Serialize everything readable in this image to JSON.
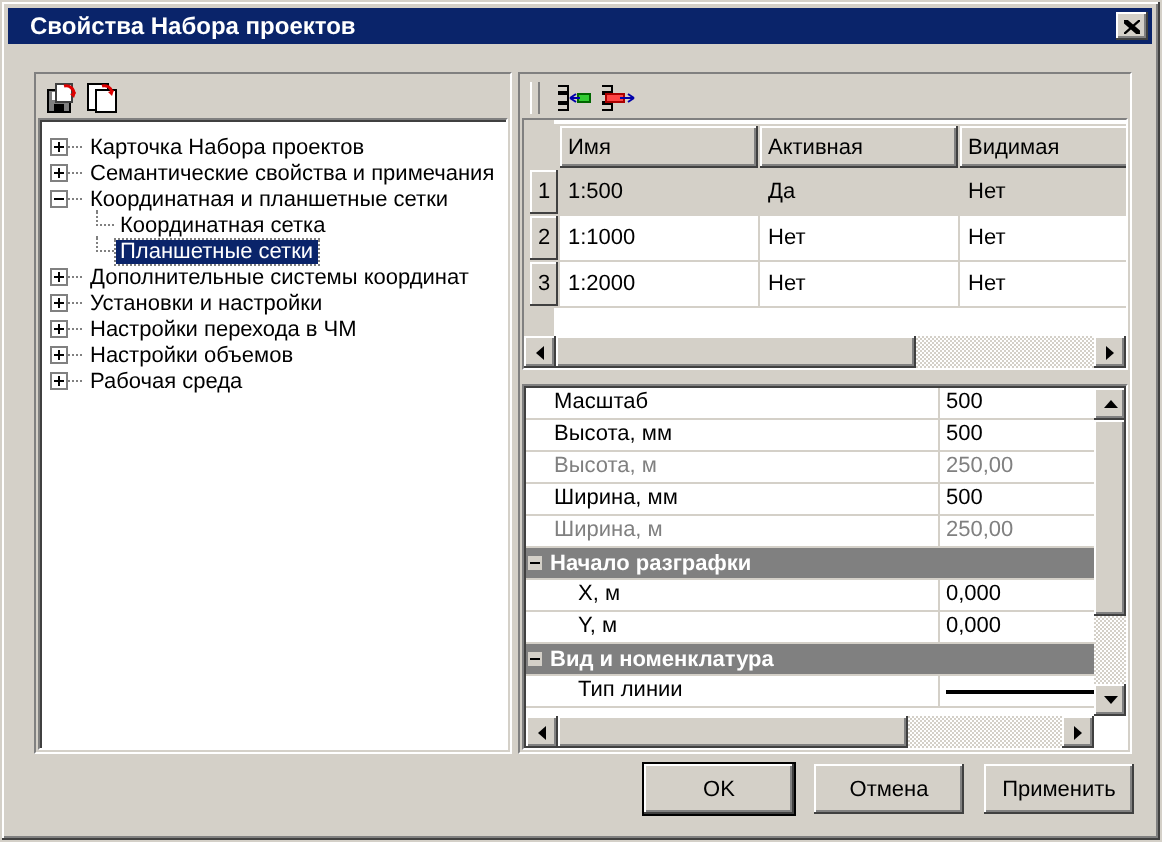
{
  "window": {
    "title": "Свойства Набора проектов"
  },
  "tree": [
    {
      "label": "Карточка Набора проектов",
      "expanded": false,
      "selected": false
    },
    {
      "label": "Семантические свойства и примечания",
      "expanded": false,
      "selected": false
    },
    {
      "label": "Координатная и планшетные сетки",
      "expanded": true,
      "selected": false,
      "children": [
        {
          "label": "Координатная сетка",
          "selected": false
        },
        {
          "label": "Планшетные сетки",
          "selected": true
        }
      ]
    },
    {
      "label": "Дополнительные системы координат",
      "expanded": false,
      "selected": false
    },
    {
      "label": "Установки и настройки",
      "expanded": false,
      "selected": false
    },
    {
      "label": "Настройки перехода в ЧМ",
      "expanded": false,
      "selected": false
    },
    {
      "label": "Настройки объемов",
      "expanded": false,
      "selected": false
    },
    {
      "label": "Рабочая среда",
      "expanded": false,
      "selected": false
    }
  ],
  "table": {
    "columns": [
      "Имя",
      "Активная",
      "Видимая"
    ],
    "rows": [
      {
        "number": "1",
        "cells": [
          "1:500",
          "Да",
          "Нет"
        ],
        "selected": true
      },
      {
        "number": "2",
        "cells": [
          "1:1000",
          "Нет",
          "Нет"
        ],
        "selected": false
      },
      {
        "number": "3",
        "cells": [
          "1:2000",
          "Нет",
          "Нет"
        ],
        "selected": false
      }
    ]
  },
  "properties": [
    {
      "kind": "property",
      "label": "Масштаб",
      "value": "500",
      "disabled": false
    },
    {
      "kind": "property",
      "label": "Высота, мм",
      "value": "500",
      "disabled": false
    },
    {
      "kind": "property",
      "label": "Высота, м",
      "value": "250,00",
      "disabled": true
    },
    {
      "kind": "property",
      "label": "Ширина, мм",
      "value": "500",
      "disabled": false
    },
    {
      "kind": "property",
      "label": "Ширина, м",
      "value": "250,00",
      "disabled": true
    },
    {
      "kind": "group",
      "label": "Начало разграфки",
      "expanded": true,
      "children": [
        {
          "kind": "property",
          "label": "X, м",
          "value": "0,000",
          "disabled": false
        },
        {
          "kind": "property",
          "label": "Y, м",
          "value": "0,000",
          "disabled": false
        }
      ]
    },
    {
      "kind": "group",
      "label": "Вид и номенклатура",
      "expanded": true,
      "children": [
        {
          "kind": "line",
          "label": "Тип линии"
        }
      ]
    }
  ],
  "buttons": [
    {
      "label": "OK",
      "default": true
    },
    {
      "label": "Отмена",
      "default": false
    },
    {
      "label": "Применить",
      "default": false
    }
  ]
}
